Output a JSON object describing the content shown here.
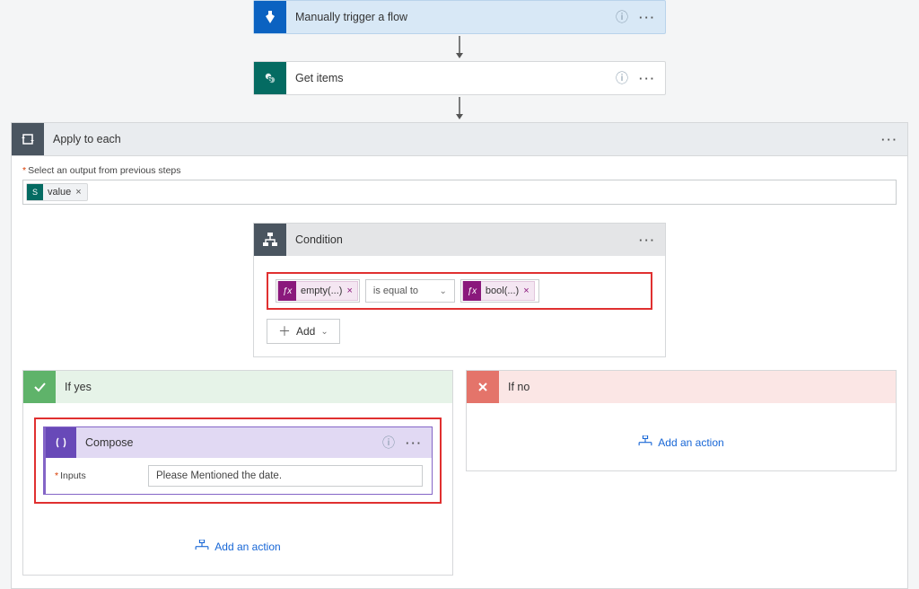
{
  "trigger": {
    "title": "Manually trigger a flow"
  },
  "get_items": {
    "title": "Get items"
  },
  "apply": {
    "title": "Apply to each",
    "output_label": "Select an output from previous steps",
    "value_token": "value"
  },
  "condition": {
    "title": "Condition",
    "left_expr": "empty(...)",
    "operator": "is equal to",
    "right_expr": "bool(...)",
    "add_label": "Add"
  },
  "yes": {
    "title": "If yes",
    "compose_title": "Compose",
    "inputs_label": "Inputs",
    "inputs_value": "Please Mentioned the date.",
    "add_action": "Add an action"
  },
  "no": {
    "title": "If no",
    "add_action": "Add an action"
  }
}
